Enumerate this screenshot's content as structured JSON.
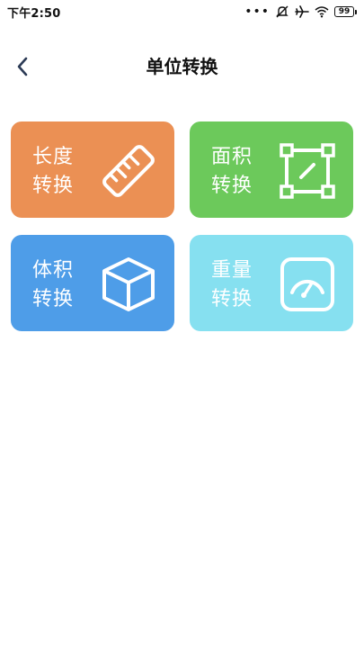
{
  "status_bar": {
    "time": "下午2:50",
    "dots": "•••",
    "battery": "99"
  },
  "header": {
    "title": "单位转换",
    "back_icon": "chevron-left-icon"
  },
  "cards": [
    {
      "line1": "长度",
      "line2": "转换",
      "color": "#EB9054",
      "icon": "ruler-icon"
    },
    {
      "line1": "面积",
      "line2": "转换",
      "color": "#6CC95B",
      "icon": "area-square-icon"
    },
    {
      "line1": "体积",
      "line2": "转换",
      "color": "#4E9DE8",
      "icon": "cube-icon"
    },
    {
      "line1": "重量",
      "line2": "转换",
      "color": "#86E0F0",
      "icon": "gauge-icon"
    }
  ]
}
